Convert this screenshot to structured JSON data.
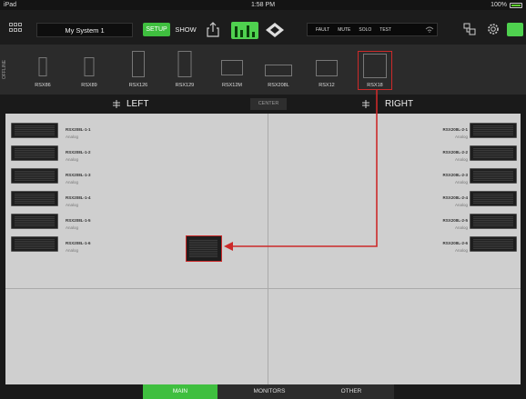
{
  "status": {
    "left": "iPad",
    "time": "1:58 PM",
    "battery": "100%"
  },
  "toolbar": {
    "system_name": "My System 1",
    "setup_label": "SETUP",
    "show_label": "SHOW",
    "meters": [
      "FAULT",
      "MUTE",
      "SOLO",
      "TEST"
    ],
    "accent": "#3fbf3f"
  },
  "palette": {
    "offline_label": "OFFLINE",
    "items": [
      "RSX86",
      "RSX89",
      "RSX126",
      "RSX129",
      "RSX12M",
      "RSX208L",
      "RSX12",
      "RSX18"
    ],
    "selected": "RSX18"
  },
  "zones": {
    "left": "LEFT",
    "center": "CENTER",
    "right": "RIGHT"
  },
  "left_speakers": [
    {
      "name": "RSX208L-1-1",
      "sub": "Analog"
    },
    {
      "name": "RSX208L-1-2",
      "sub": "Analog"
    },
    {
      "name": "RSX208L-1-3",
      "sub": "Analog"
    },
    {
      "name": "RSX208L-1-4",
      "sub": "Analog"
    },
    {
      "name": "RSX208L-1-5",
      "sub": "Analog"
    },
    {
      "name": "RSX208L-1-6",
      "sub": "Analog"
    }
  ],
  "right_speakers": [
    {
      "name": "RSX208L-2-1",
      "sub": "Analog"
    },
    {
      "name": "RSX208L-2-2",
      "sub": "Analog"
    },
    {
      "name": "RSX208L-2-3",
      "sub": "Analog"
    },
    {
      "name": "RSX208L-2-4",
      "sub": "Analog"
    },
    {
      "name": "RSX208L-2-5",
      "sub": "Analog"
    },
    {
      "name": "RSX208L-2-6",
      "sub": "Analog"
    }
  ],
  "tabs": [
    "MAIN",
    "MONITORS",
    "OTHER"
  ],
  "active_tab": "MAIN",
  "highlight_color": "#cc2a2a"
}
